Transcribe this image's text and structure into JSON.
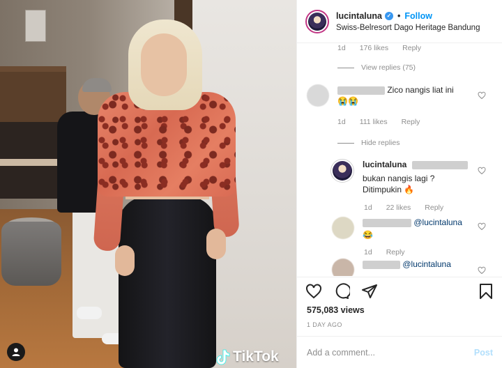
{
  "header": {
    "username": "lucintaluna",
    "follow_label": "Follow",
    "separator": "•",
    "location": "Swiss-Belresort Dago Heritage Bandung"
  },
  "media": {
    "watermark": "TikTok"
  },
  "comments": {
    "top_meta": {
      "time": "1d",
      "likes": "176 likes",
      "reply": "Reply"
    },
    "view_replies": "View replies (75)",
    "c1": {
      "text": "Zico nangis liat ini",
      "emoji": "😭😭"
    },
    "c1_meta": {
      "time": "1d",
      "likes": "111 likes",
      "reply": "Reply"
    },
    "hide_replies": "Hide replies",
    "r1": {
      "username": "lucintaluna",
      "text": "bukan nangis lagi ? Ditimpukin",
      "emoji": "🔥"
    },
    "r1_meta": {
      "time": "1d",
      "likes": "22 likes",
      "reply": "Reply"
    },
    "r2": {
      "mention": "@lucintaluna",
      "emoji": "😂"
    },
    "r2_meta": {
      "time": "1d",
      "reply": "Reply"
    },
    "r3": {
      "mention": "@lucintaluna"
    }
  },
  "actions": {
    "views": "575,083 views",
    "date": "1 DAY AGO"
  },
  "add_comment": {
    "placeholder": "Add a comment...",
    "post_label": "Post"
  },
  "colors": {
    "accent": "#0095f6",
    "post_disabled": "#b2dffc",
    "muted": "#8e8e8e",
    "text": "#262626"
  }
}
